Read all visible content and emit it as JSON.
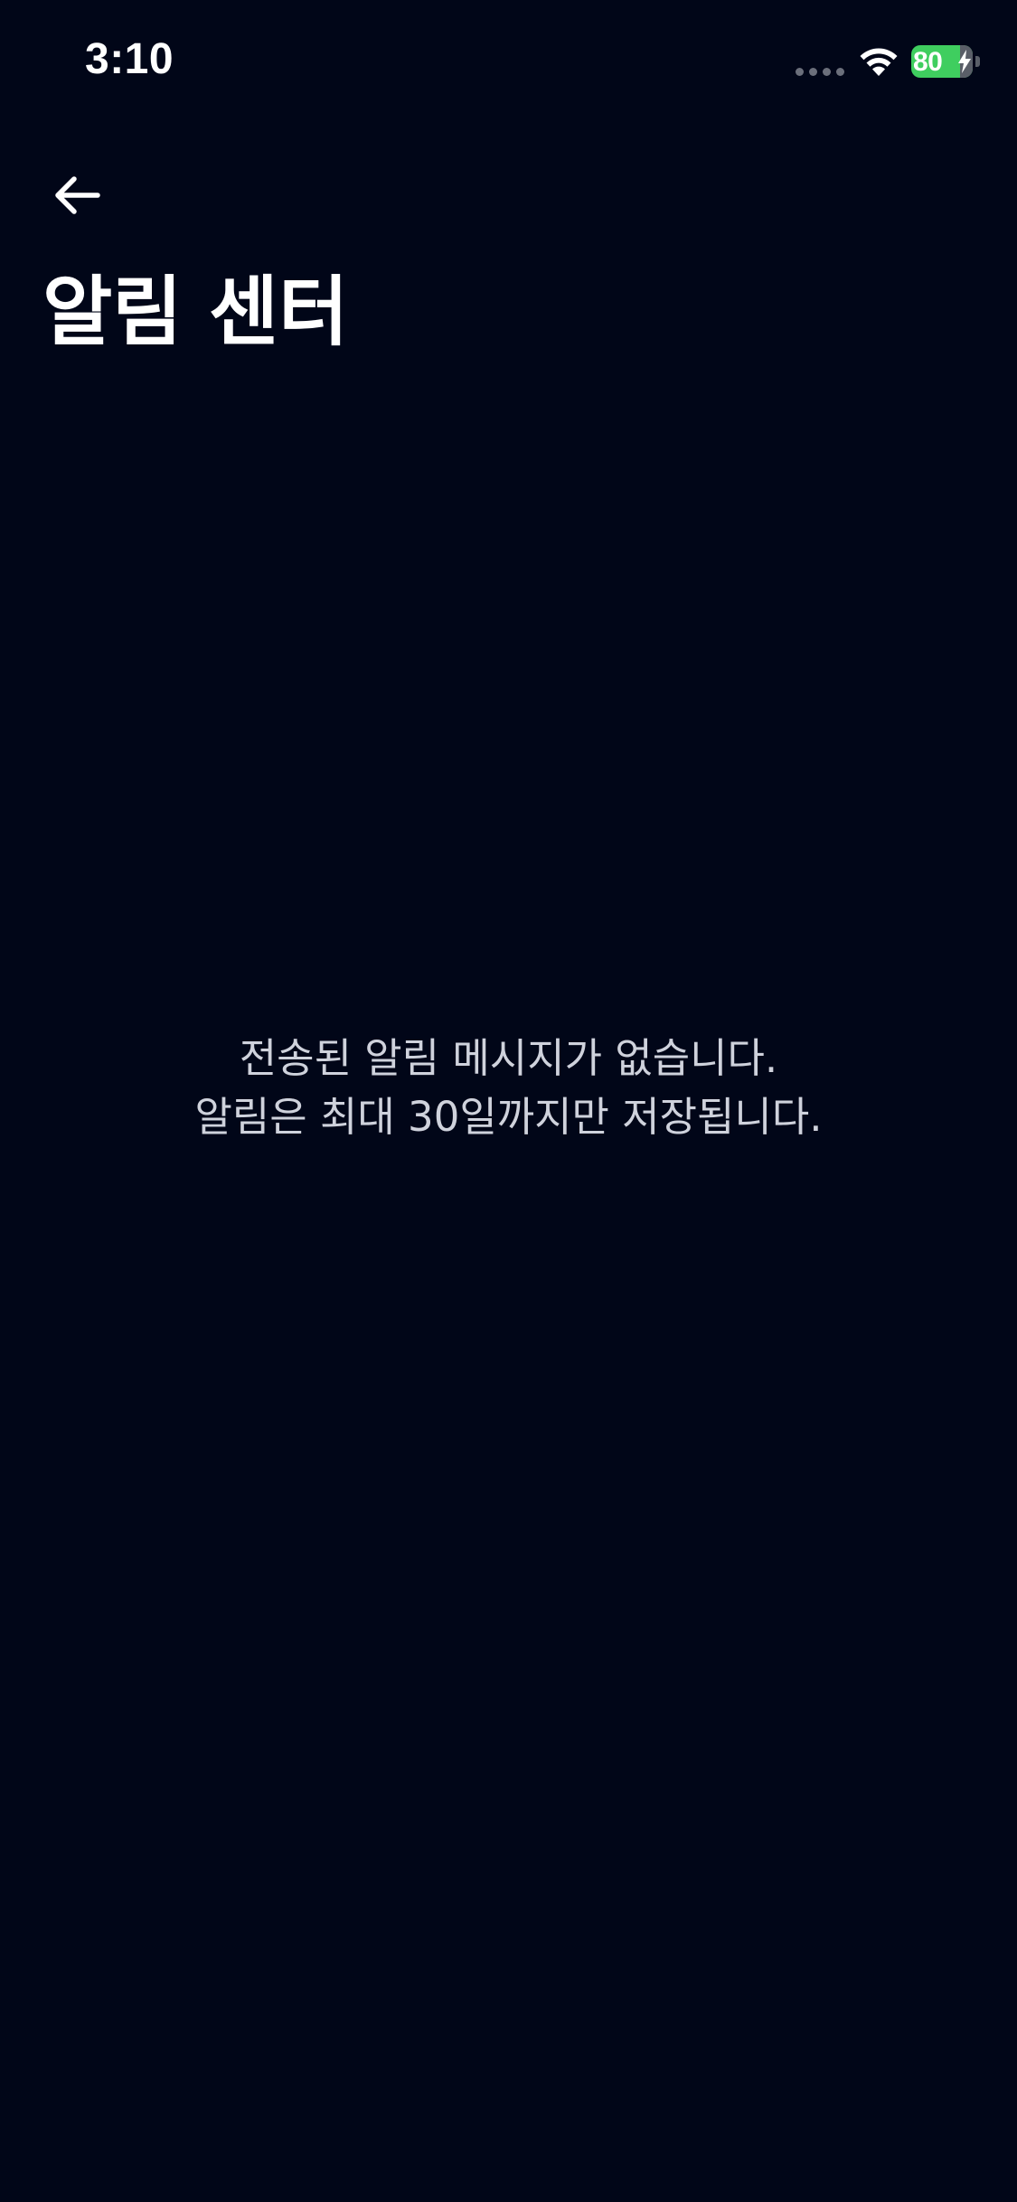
{
  "status_bar": {
    "time": "3:10",
    "battery_level": "80",
    "battery_fraction": 0.8,
    "icons": [
      "signal-dots-icon",
      "wifi-icon",
      "battery-icon",
      "charging-bolt-icon"
    ]
  },
  "header": {
    "back_icon": "arrow-left-icon",
    "title": "알림 센터"
  },
  "empty_state": {
    "line1": "전송된 알림 메시지가 없습니다.",
    "line2": "알림은 최대 30일까지만 저장됩니다."
  },
  "colors": {
    "background": "#010618",
    "text_primary": "#ffffff",
    "text_secondary": "#cfd2dc",
    "battery_green": "#3fce5f"
  }
}
